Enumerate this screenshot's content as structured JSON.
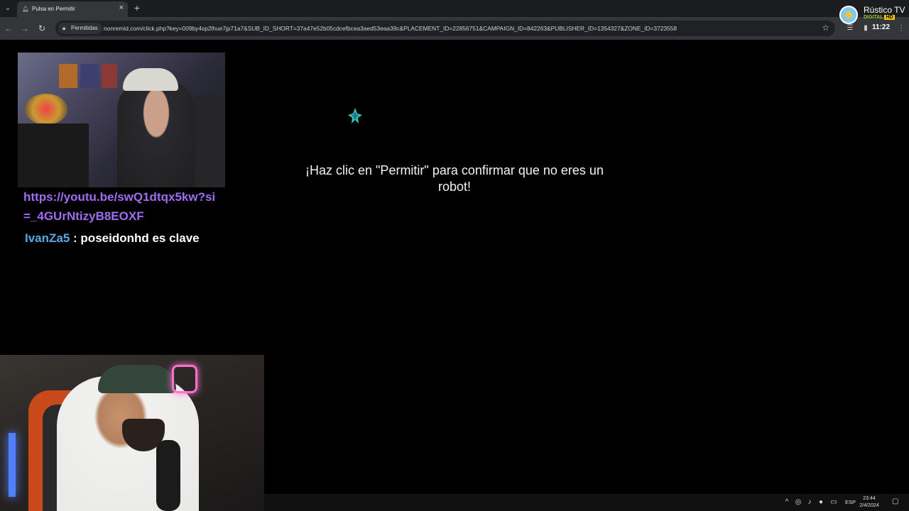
{
  "browser": {
    "tab_title": "Pulsa en Permitir",
    "new_tab_symbol": "+",
    "permission_chip": "Permitidas",
    "url": "nonremid.com/click.php?key=009by4sp2lhue7jp71a7&SUB_ID_SHORT=37a47e52b05cdcefbcea3aed53eaa39c&PLACEMENT_ID=22856751&CAMPAIGN_ID=842263&PUBLISHER_ID=1354327&ZONE_ID=3723558",
    "clock": "11:22"
  },
  "broadcast_logo": {
    "name": "Rústico TV",
    "sub": "DIGITAL",
    "badge": "HD"
  },
  "page": {
    "prompt": "¡Haz clic en \"Permitir\" para confirmar que no eres un robot!"
  },
  "chat": {
    "link": "https://youtu.be/swQ1dtqx5kw?si=_4GUrNtizyB8EOXF",
    "user": "IvanZa5",
    "separator": " : ",
    "message": "poseidonhd es clave"
  },
  "taskbar": {
    "language": "ESP",
    "time": "23:44",
    "date": "2/4/2024"
  },
  "colors": {
    "chat_link": "#a06cf0",
    "chat_user": "#5aa8e0",
    "page_background": "#000000"
  }
}
